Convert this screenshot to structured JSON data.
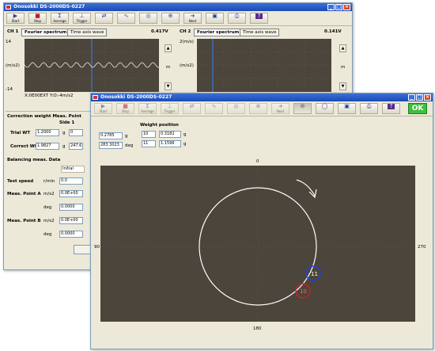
{
  "back_window": {
    "title": "Onosokki DS-2000DS-0227",
    "toolbar": [
      {
        "label": "Start",
        "icon": "start-icon",
        "glyph": "▶"
      },
      {
        "label": "Stop",
        "icon": "stop-icon",
        "glyph": "■"
      },
      {
        "label": "Average",
        "icon": "average-icon",
        "glyph": "Σ"
      },
      {
        "label": "Trigger",
        "icon": "trigger-icon",
        "glyph": "⊥"
      },
      {
        "label": "",
        "icon": "channel-icon",
        "glyph": "⇄"
      },
      {
        "label": "",
        "icon": "calibration-icon",
        "glyph": "∿"
      },
      {
        "label": "",
        "icon": "phase-icon",
        "glyph": "◎"
      },
      {
        "label": "",
        "icon": "correction-icon",
        "glyph": "⊕"
      },
      {
        "label": "Next",
        "icon": "next-icon",
        "glyph": "➔"
      },
      {
        "label": "",
        "icon": "save-icon",
        "glyph": "▣"
      },
      {
        "label": "",
        "icon": "print-icon",
        "glyph": "⎙"
      },
      {
        "label": "",
        "icon": "help-icon",
        "glyph": "?"
      }
    ],
    "ch1": {
      "name": "CH 1",
      "tab_fourier": "Fourier spectrum",
      "tab_time": "Time axis wave",
      "value": "0.417V",
      "ytop": "14",
      "ybottom": "-14",
      "yunit": "(m/s2)",
      "xaxis": "X:0E00EXT Y:O:-4m/s2",
      "unit_side": "m"
    },
    "ch2": {
      "name": "CH 2",
      "tab_fourier": "Fourier spectrum",
      "tab_time": "Time axis wave",
      "value": "0.141V",
      "ytop": "2(m/s)",
      "yunit": "(m/s2)",
      "unit_side": "m"
    },
    "correction": {
      "header": "Correction weight Meas. Point",
      "side": "Side 1",
      "trial_label": "Trial WT",
      "trial_val": "1.2000",
      "trial_unit": "g",
      "trial_val2": "0",
      "correct_label": "Correct Wt",
      "correct_val": "1.9827",
      "correct_unit": "g",
      "correct_val2": "247.6"
    },
    "balancing": {
      "header": "Balancing meas. Data",
      "initial": "Initial",
      "test_speed_label": "Test speed",
      "test_speed_unit": "r/min",
      "test_speed_val": "0.0",
      "meas_a_label": "Meas. Point A",
      "meas_a_unit": "m/s2",
      "meas_a_val": "0.0E+00",
      "meas_a_deg_unit": "deg",
      "meas_a_deg": "0.0000",
      "meas_b_label": "Meas. Point B",
      "meas_b_unit": "m/s2",
      "meas_b_val": "0.0E+00",
      "meas_b_deg_unit": "deg",
      "meas_b_deg": "0.0000"
    }
  },
  "front_window": {
    "title": "Onosokki DS-2000DS-0227",
    "toolbar": [
      {
        "label": "Start",
        "icon": "start-icon",
        "glyph": "▶",
        "dim": true
      },
      {
        "label": "Stop",
        "icon": "stop-icon",
        "glyph": "■",
        "dim": true
      },
      {
        "label": "Average",
        "icon": "average-icon",
        "glyph": "Σ",
        "dim": true
      },
      {
        "label": "Trigger",
        "icon": "trigger-icon",
        "glyph": "⊥",
        "dim": true
      },
      {
        "label": "",
        "icon": "channel-icon",
        "glyph": "⇄",
        "dim": true
      },
      {
        "label": "",
        "icon": "calibration-icon",
        "glyph": "∿",
        "dim": true
      },
      {
        "label": "",
        "icon": "phase-icon",
        "glyph": "◎",
        "dim": true
      },
      {
        "label": "",
        "icon": "correction-icon",
        "glyph": "⊕",
        "dim": true
      },
      {
        "label": "Next",
        "icon": "next-icon",
        "glyph": "➔",
        "dim": true
      },
      {
        "label": "",
        "icon": "polar-icon",
        "glyph": "⊖",
        "active": true
      },
      {
        "label": "",
        "icon": "circle-icon",
        "glyph": "◯"
      },
      {
        "label": "",
        "icon": "save-icon",
        "glyph": "▣"
      },
      {
        "label": "",
        "icon": "print-icon",
        "glyph": "⎙"
      },
      {
        "label": "",
        "icon": "help-icon",
        "glyph": "?"
      }
    ],
    "ok_label": "OK",
    "weight": {
      "left_val": "0.2785",
      "left_unit": "g",
      "left_deg": "283.3023",
      "left_deg_unit": "deg"
    },
    "weight_position": {
      "header": "Weight position",
      "rows": [
        {
          "index": "10",
          "val": "0.3182",
          "unit": "g"
        },
        {
          "index": "11",
          "val": "1.1596",
          "unit": "g"
        }
      ]
    },
    "polar": {
      "top": "0",
      "bottom": "180",
      "left": "90",
      "right": "270",
      "marker_a": "11",
      "marker_b": "10"
    }
  },
  "colors": {
    "plot_bg": "#4b453b",
    "titlebar": "#1a4bb5",
    "ok": "#3fbf3f",
    "marker_blue": "#2a3fd0",
    "marker_red": "#d02020"
  }
}
